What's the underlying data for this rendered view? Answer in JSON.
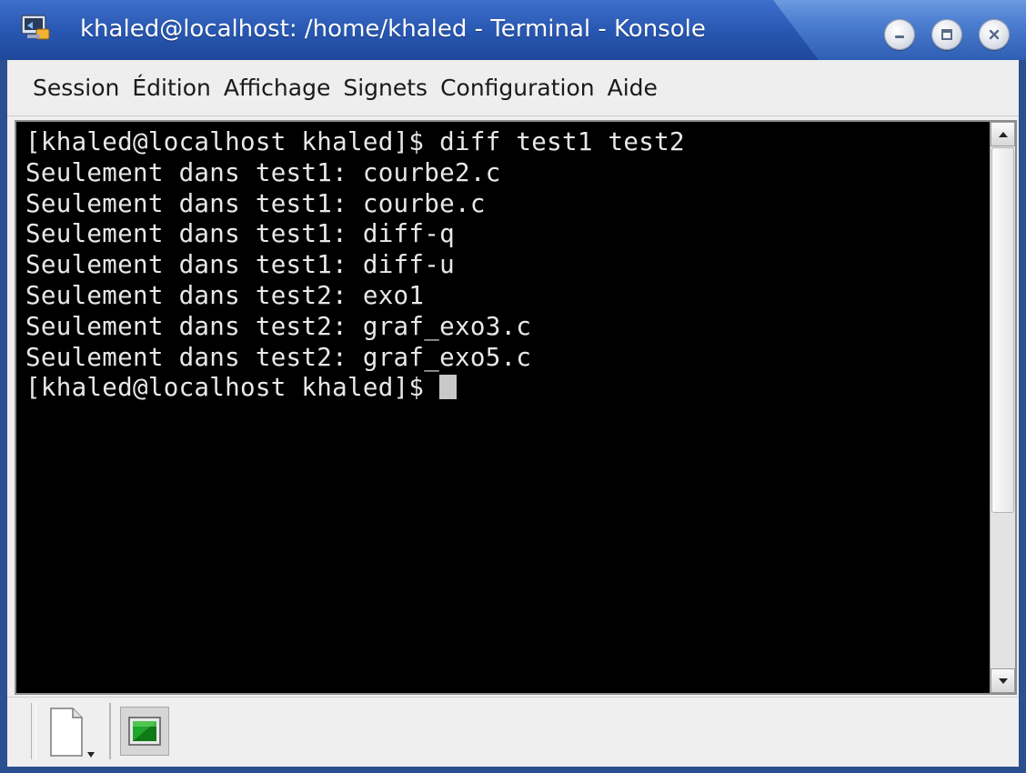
{
  "window": {
    "title": "khaled@localhost: /home/khaled - Terminal - Konsole"
  },
  "titlebar_buttons": {
    "minimize_icon": "minimize-icon",
    "maximize_icon": "maximize-icon",
    "close_icon": "close-icon"
  },
  "menu": {
    "items": [
      {
        "label": "Session"
      },
      {
        "label": "Édition"
      },
      {
        "label": "Affichage"
      },
      {
        "label": "Signets"
      },
      {
        "label": "Configuration"
      },
      {
        "label": "Aide"
      }
    ]
  },
  "terminal": {
    "lines": [
      "[khaled@localhost khaled]$ diff test1 test2",
      "Seulement dans test1: courbe2.c",
      "Seulement dans test1: courbe.c",
      "Seulement dans test1: diff-q",
      "Seulement dans test1: diff-u",
      "Seulement dans test2: exo1",
      "Seulement dans test2: graf_exo3.c",
      "Seulement dans test2: graf_exo5.c"
    ],
    "prompt": "[khaled@localhost khaled]$ "
  },
  "colors": {
    "titlebar": "#2756b0",
    "terminal_bg": "#000000",
    "terminal_fg": "#e8e8e8",
    "window_bg": "#efefef"
  }
}
